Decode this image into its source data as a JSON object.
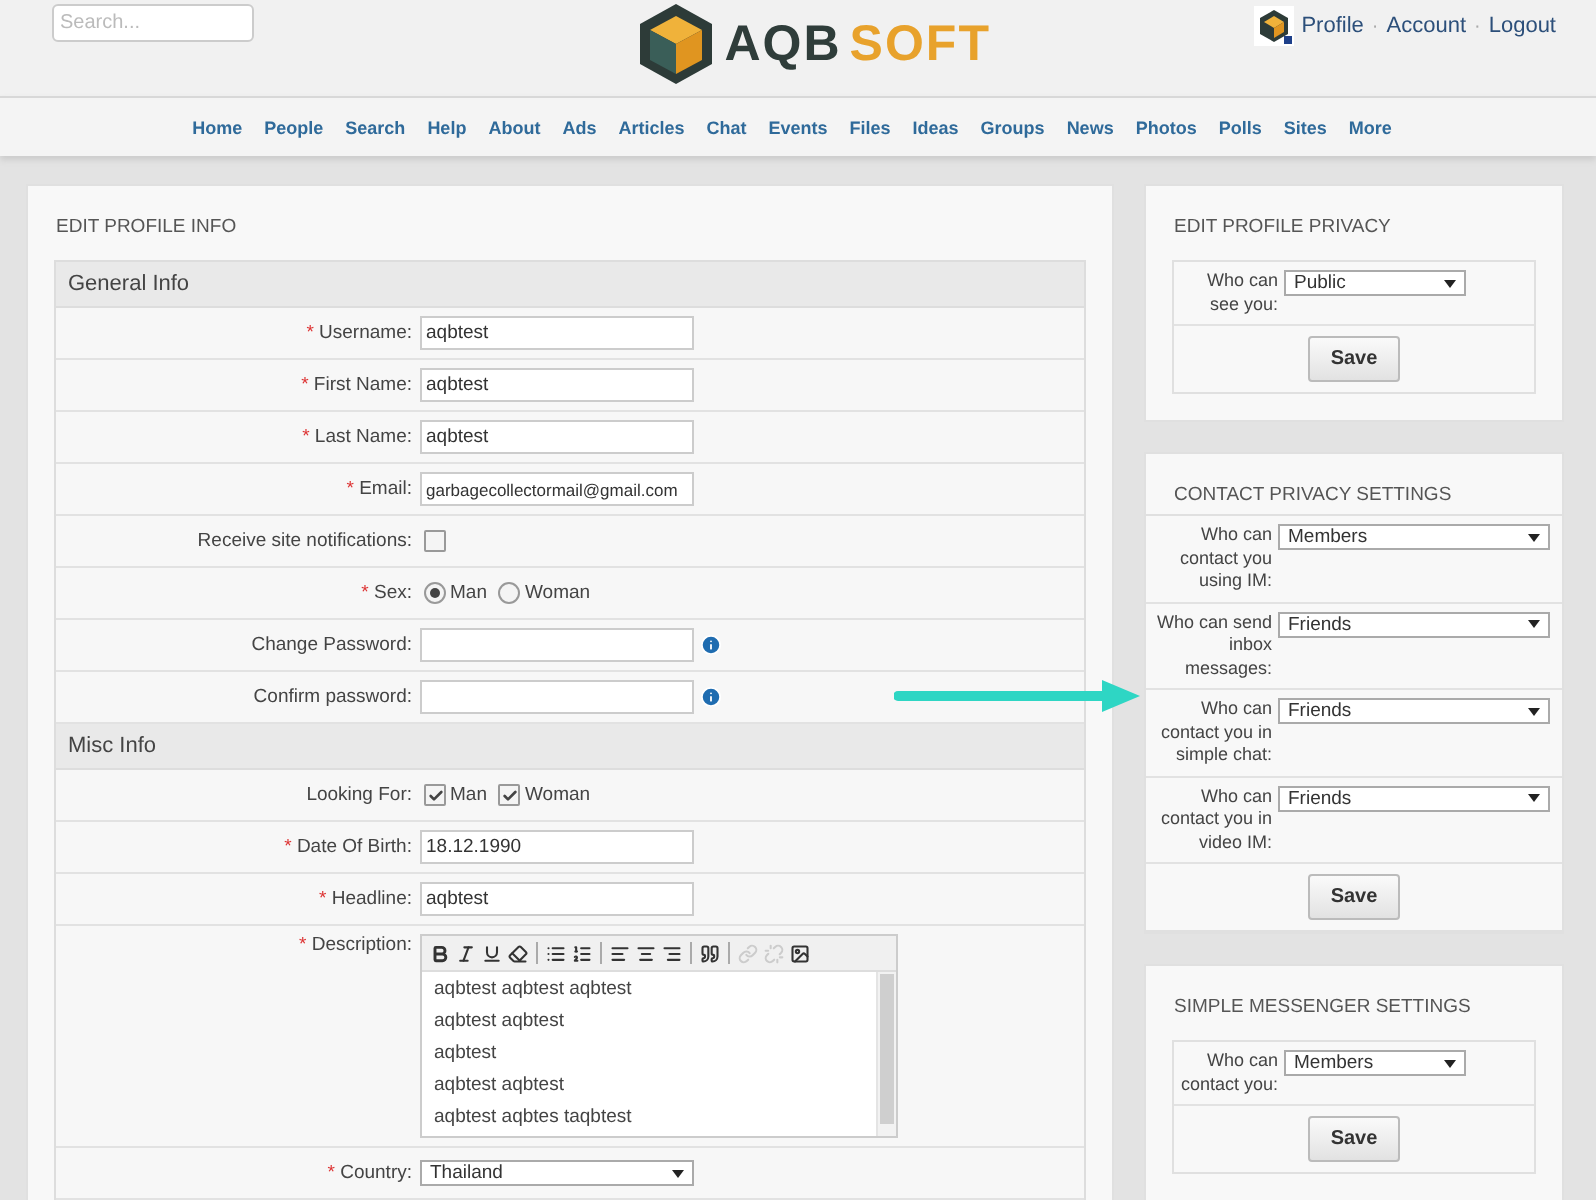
{
  "header": {
    "search": {
      "placeholder": "Search..."
    },
    "logo": {
      "part_1": "AQB",
      "part_2": "SOFT"
    },
    "user_links": [
      "Profile",
      "Account",
      "Logout"
    ],
    "separator": "·"
  },
  "nav": [
    "Home",
    "People",
    "Search",
    "Help",
    "About",
    "Ads",
    "Articles",
    "Chat",
    "Events",
    "Files",
    "Ideas",
    "Groups",
    "News",
    "Photos",
    "Polls",
    "Sites",
    "More"
  ],
  "profile_form": {
    "title": "EDIT PROFILE INFO",
    "required_mark": "*",
    "sections": [
      {
        "title": "General Info",
        "rows": [
          {
            "kind": "text",
            "label": "Username:",
            "required": true,
            "value": "aqbtest"
          },
          {
            "kind": "text",
            "label": "First Name:",
            "required": true,
            "value": "aqbtest"
          },
          {
            "kind": "text",
            "label": "Last Name:",
            "required": true,
            "value": "aqbtest"
          },
          {
            "kind": "text",
            "label": "Email:",
            "required": true,
            "value": "garbagecollectormail@gmail.com"
          },
          {
            "kind": "checkbox",
            "label": "Receive site notifications:",
            "required": false,
            "checked": false
          },
          {
            "kind": "radio",
            "label": "Sex:",
            "required": true,
            "options": [
              {
                "label": "Man",
                "selected": true
              },
              {
                "label": "Woman",
                "selected": false
              }
            ]
          },
          {
            "kind": "password",
            "label": "Change Password:",
            "required": false,
            "info": true
          },
          {
            "kind": "password",
            "label": "Confirm password:",
            "required": false,
            "info": true
          }
        ]
      },
      {
        "title": "Misc Info",
        "rows": [
          {
            "kind": "checkboxes",
            "label": "Looking For:",
            "required": false,
            "options": [
              {
                "label": "Man",
                "checked": true
              },
              {
                "label": "Woman",
                "checked": true
              }
            ]
          },
          {
            "kind": "text",
            "label": "Date Of Birth:",
            "required": true,
            "value": "18.12.1990"
          },
          {
            "kind": "text",
            "label": "Headline:",
            "required": true,
            "value": "aqbtest"
          },
          {
            "kind": "editor",
            "label": "Description:",
            "required": true,
            "toolbar": [
              {
                "kind": "bold",
                "disabled": false
              },
              {
                "kind": "italic",
                "disabled": false
              },
              {
                "kind": "underline",
                "disabled": false
              },
              {
                "kind": "eraser",
                "disabled": false
              },
              {
                "kind": "sep"
              },
              {
                "kind": "bullets",
                "disabled": false
              },
              {
                "kind": "numbers",
                "disabled": false
              },
              {
                "kind": "sep"
              },
              {
                "kind": "left",
                "disabled": false
              },
              {
                "kind": "center",
                "disabled": false
              },
              {
                "kind": "right",
                "disabled": false
              },
              {
                "kind": "sep"
              },
              {
                "kind": "quote",
                "disabled": false
              },
              {
                "kind": "sep"
              },
              {
                "kind": "link",
                "disabled": true
              },
              {
                "kind": "unlink",
                "disabled": true
              },
              {
                "kind": "image",
                "disabled": false
              }
            ],
            "lines": [
              "aqbtest aqbtest aqbtest",
              "aqbtest aqbtest",
              "aqbtest",
              "aqbtest aqbtest",
              "aqbtest aqbtes taqbtest"
            ]
          },
          {
            "kind": "select",
            "label": "Country:",
            "required": true,
            "value": "Thailand"
          }
        ]
      }
    ]
  },
  "side_panels": [
    {
      "title": "EDIT PROFILE PRIVACY",
      "inset": true,
      "rows": [
        {
          "label": "Who can see you:",
          "value": "Public"
        }
      ],
      "button": "Save"
    },
    {
      "title": "CONTACT PRIVACY SETTINGS",
      "inset": false,
      "rows": [
        {
          "label": "Who can contact you using IM:",
          "value": "Members"
        },
        {
          "label": "Who can send inbox messages:",
          "value": "Friends"
        },
        {
          "label": "Who can contact you in simple chat:",
          "value": "Friends"
        },
        {
          "label": "Who can contact you in video IM:",
          "value": "Friends"
        }
      ],
      "button": "Save"
    },
    {
      "title": "SIMPLE MESSENGER SETTINGS",
      "inset": true,
      "rows": [
        {
          "label": "Who can contact you:",
          "value": "Members"
        }
      ],
      "button": "Save"
    }
  ]
}
